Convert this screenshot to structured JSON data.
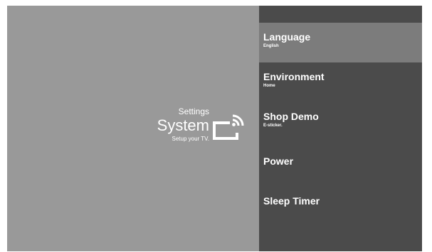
{
  "header": {
    "breadcrumb": "Settings",
    "title": "System",
    "subtitle": "Setup your TV."
  },
  "icon": {
    "name": "cast-icon",
    "color": "#ffffff"
  },
  "colors": {
    "left_panel": "#999999",
    "right_panel": "#4b4b4b",
    "selected_item": "#7c7c7c",
    "text": "#ffffff"
  },
  "menu": {
    "items": [
      {
        "label": "Language",
        "value": "English",
        "selected": true
      },
      {
        "label": "Environment",
        "value": "Home",
        "selected": false
      },
      {
        "label": "Shop Demo",
        "value": "E-sticker.",
        "selected": false
      },
      {
        "label": "Power",
        "value": "",
        "selected": false
      },
      {
        "label": "Sleep Timer",
        "value": "",
        "selected": false
      }
    ]
  }
}
